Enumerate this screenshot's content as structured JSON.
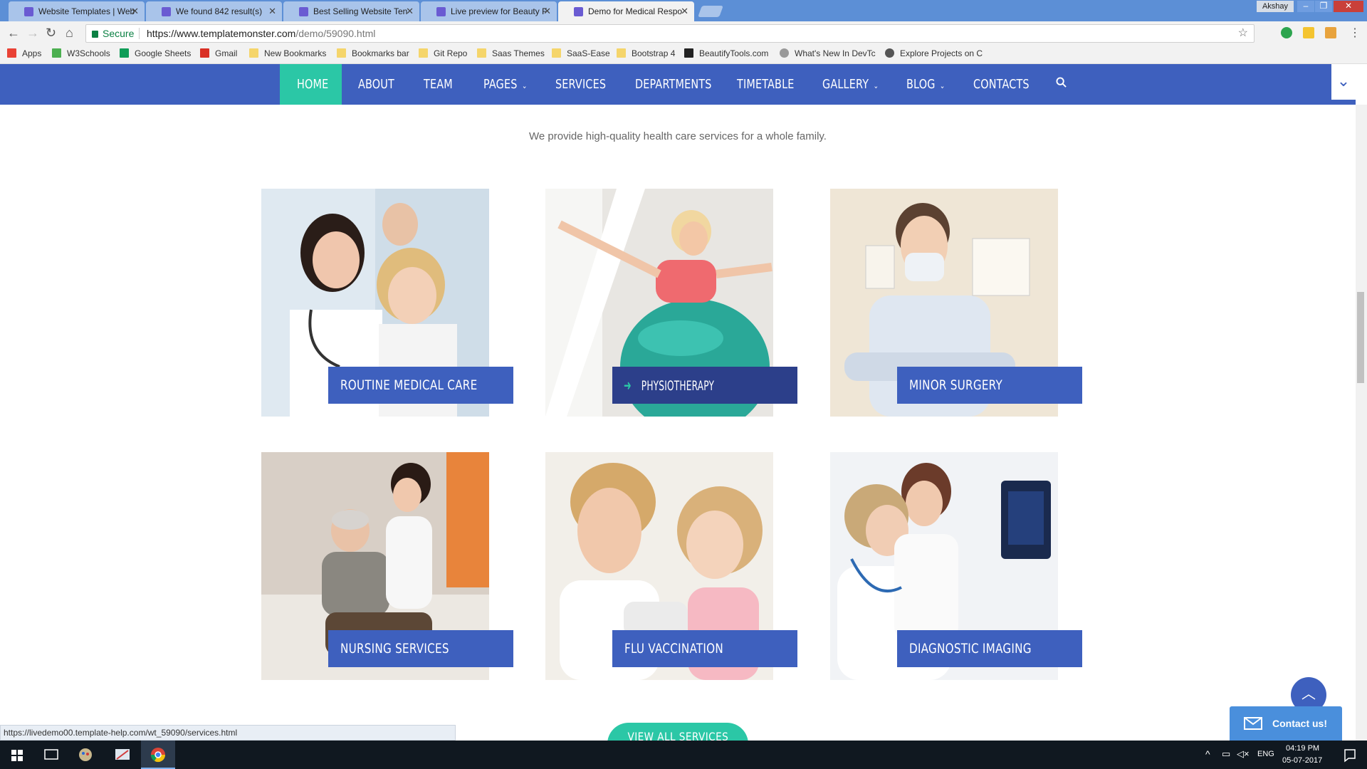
{
  "browser": {
    "tabs": [
      {
        "title": "Website Templates | Web",
        "active": false
      },
      {
        "title": "We found 842 result(s)",
        "active": false
      },
      {
        "title": "Best Selling Website Ten",
        "active": false
      },
      {
        "title": "Live preview for Beauty F",
        "active": false
      },
      {
        "title": "Demo for Medical Respo",
        "active": true
      }
    ],
    "tab_close": "✕",
    "user_name": "Akshay",
    "window_buttons": {
      "minimize": "–",
      "restore": "❐",
      "close": "✕"
    },
    "secure_label": "Secure",
    "url_host": "https://www.templatemonster.com",
    "url_path": "/demo/59090.html",
    "bookmarks": [
      "Apps",
      "W3Schools",
      "Google Sheets",
      "Gmail",
      "New Bookmarks",
      "Bookmarks bar",
      "Git Repo",
      "Saas Themes",
      "SaaS-Ease",
      "Bootstrap 4",
      "BeautifyTools.com",
      "What's New In DevTc",
      "Explore Projects on C"
    ],
    "status_url": "https://livedemo00.template-help.com/wt_59090/services.html"
  },
  "nav": {
    "items": [
      "HOME",
      "ABOUT",
      "TEAM",
      "PAGES",
      "SERVICES",
      "DEPARTMENTS",
      "TIMETABLE",
      "GALLERY",
      "BLOG",
      "CONTACTS"
    ],
    "dropdown_caret": "⌄",
    "active_item": "HOME"
  },
  "section": {
    "subtitle": "We provide high-quality health care services for a whole family."
  },
  "services": [
    {
      "label": "ROUTINE MEDICAL CARE"
    },
    {
      "label": "PHYSIOTHERAPY",
      "hovered": true,
      "arrow": "➜"
    },
    {
      "label": "MINOR SURGERY"
    },
    {
      "label": "NURSING SERVICES"
    },
    {
      "label": "FLU VACCINATION"
    },
    {
      "label": "DIAGNOSTIC IMAGING"
    }
  ],
  "view_all_label": "VIEW ALL SERVICES",
  "contact_label": "Contact us!",
  "taskbar": {
    "time": "04:19 PM",
    "date": "05-07-2017",
    "lang": "ENG"
  },
  "colors": {
    "nav_blue": "#3e60be",
    "accent_green": "#2bc7a6",
    "active_label": "#2c3f8a"
  }
}
